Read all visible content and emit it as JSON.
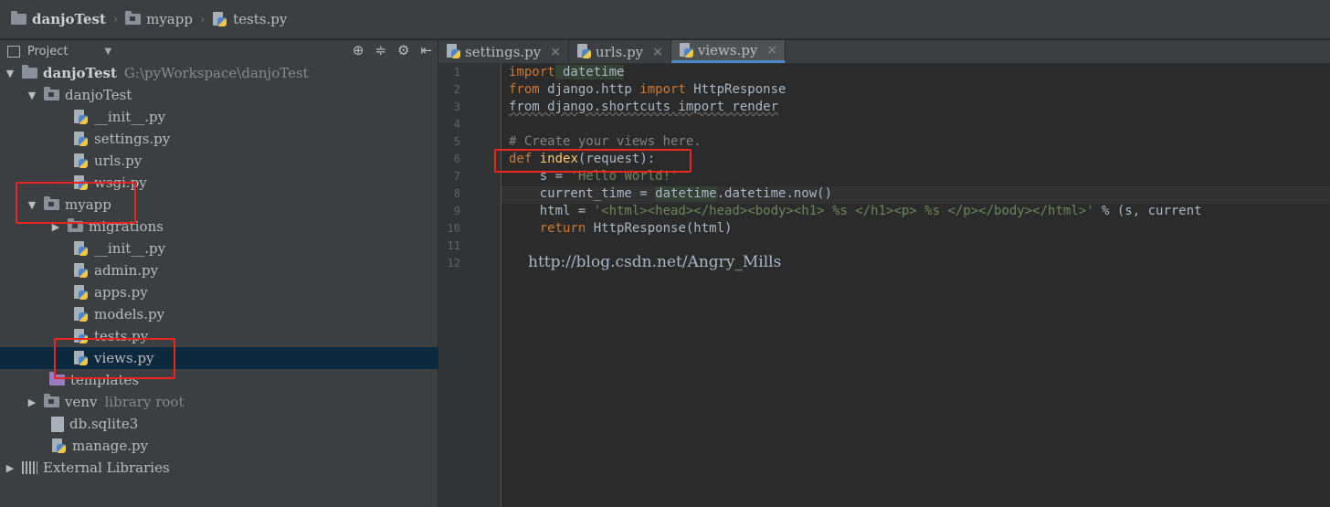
{
  "breadcrumb": {
    "items": [
      "danjoTest",
      "myapp",
      "tests.py"
    ]
  },
  "panel": {
    "title": "Project"
  },
  "tree": [
    {
      "label": "danjoTest",
      "note": "G:\\pyWorkspace\\danjoTest"
    },
    {
      "label": "danjoTest"
    },
    {
      "label": "__init__.py"
    },
    {
      "label": "settings.py"
    },
    {
      "label": "urls.py"
    },
    {
      "label": "wsgi.py"
    },
    {
      "label": "myapp"
    },
    {
      "label": "migrations"
    },
    {
      "label": "__init__.py"
    },
    {
      "label": "admin.py"
    },
    {
      "label": "apps.py"
    },
    {
      "label": "models.py"
    },
    {
      "label": "tests.py"
    },
    {
      "label": "views.py"
    },
    {
      "label": "templates"
    },
    {
      "label": "venv",
      "note": "library root"
    },
    {
      "label": "db.sqlite3"
    },
    {
      "label": "manage.py"
    },
    {
      "label": "External Libraries"
    }
  ],
  "tabs": [
    {
      "label": "settings.py"
    },
    {
      "label": "urls.py"
    },
    {
      "label": "views.py"
    }
  ],
  "editor": {
    "line_numbers": [
      "1",
      "2",
      "3",
      "4",
      "5",
      "6",
      "7",
      "8",
      "9",
      "10",
      "11",
      "12"
    ],
    "code": [
      [
        [
          "kw",
          "import"
        ],
        [
          "mod",
          " datetime"
        ]
      ],
      [
        [
          "kw",
          "from"
        ],
        [
          "",
          " django.http "
        ],
        [
          "kw",
          "import"
        ],
        [
          "",
          " HttpResponse"
        ]
      ],
      [
        [
          "und",
          "from django.shortcuts import render"
        ]
      ],
      [
        [
          "",
          ""
        ]
      ],
      [
        [
          "cm",
          "# Create your views here."
        ]
      ],
      [
        [
          "kw",
          "def"
        ],
        [
          "",
          " "
        ],
        [
          "fn",
          "index"
        ],
        [
          "",
          "(request):"
        ]
      ],
      [
        [
          "",
          "    s = "
        ],
        [
          "str",
          "'Hello World!'"
        ]
      ],
      [
        [
          "",
          "    current_time = "
        ],
        [
          "mod",
          "datetime"
        ],
        [
          "",
          ".datetime.now()"
        ]
      ],
      [
        [
          "",
          "    html = "
        ],
        [
          "str",
          "'<html><head></head><body><h1> %s </h1><p> %s </p></body></html>'"
        ],
        [
          "",
          " % (s, current"
        ]
      ],
      [
        [
          "",
          "    "
        ],
        [
          "kw",
          "return"
        ],
        [
          "",
          " HttpResponse(html)"
        ]
      ],
      [
        [
          "",
          ""
        ]
      ],
      [
        [
          "",
          ""
        ]
      ]
    ],
    "watermark": "http://blog.csdn.net/Angry_Mills"
  }
}
